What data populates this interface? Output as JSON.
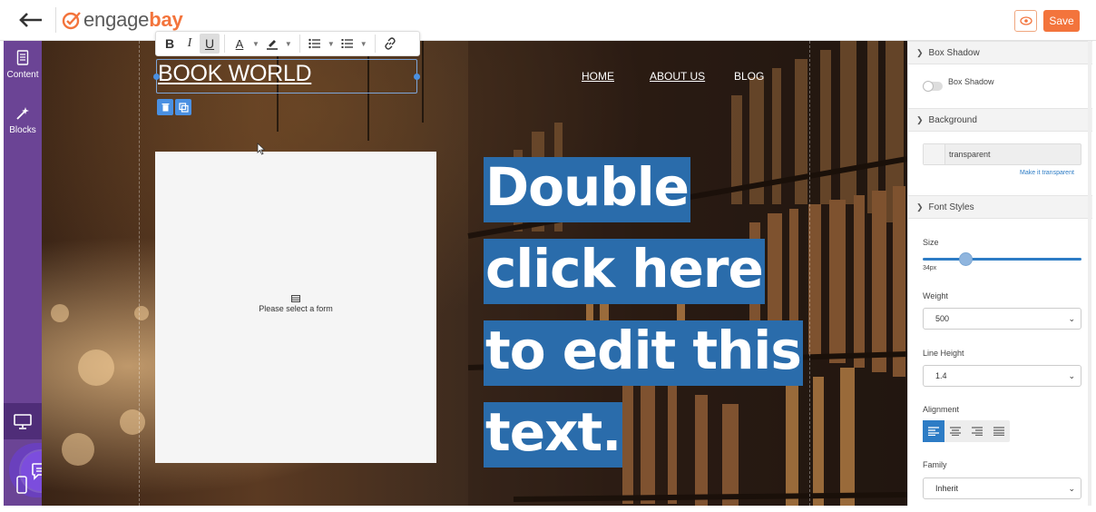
{
  "app": {
    "logo_part1": "engage",
    "logo_part2": "bay",
    "save_label": "Save"
  },
  "sidebar": {
    "items": [
      {
        "label": "Content",
        "icon": "content-icon"
      },
      {
        "label": "Blocks",
        "icon": "magic-wand-icon"
      }
    ],
    "device_icons": [
      "desktop-icon",
      "mobile-icon"
    ]
  },
  "toolbar": {
    "buttons": [
      "B",
      "I",
      "U",
      "A"
    ]
  },
  "canvas": {
    "title": "BOOK WORLD",
    "nav": [
      "HOME",
      "ABOUT US",
      "BLOG"
    ],
    "form_placeholder": "Please select a form",
    "hero_lines": [
      "Double",
      "click here",
      "to edit this",
      "text."
    ]
  },
  "panel": {
    "box_shadow_section": "Box Shadow",
    "box_shadow_toggle_label": "Box Shadow",
    "background_section": "Background",
    "background_value": "transparent",
    "make_transparent_link": "Make it transparent",
    "font_styles_section": "Font Styles",
    "size_label": "Size",
    "size_value": "34px",
    "weight_label": "Weight",
    "weight_value": "500",
    "line_height_label": "Line Height",
    "line_height_value": "1.4",
    "alignment_label": "Alignment",
    "alignment_active": "left",
    "family_label": "Family",
    "family_value": "Inherit"
  },
  "colors": {
    "brand_orange": "#f3743c",
    "sidebar_purple": "#6b4495",
    "accent_blue": "#2d7cc5",
    "hero_bg": "#2a6cab"
  }
}
